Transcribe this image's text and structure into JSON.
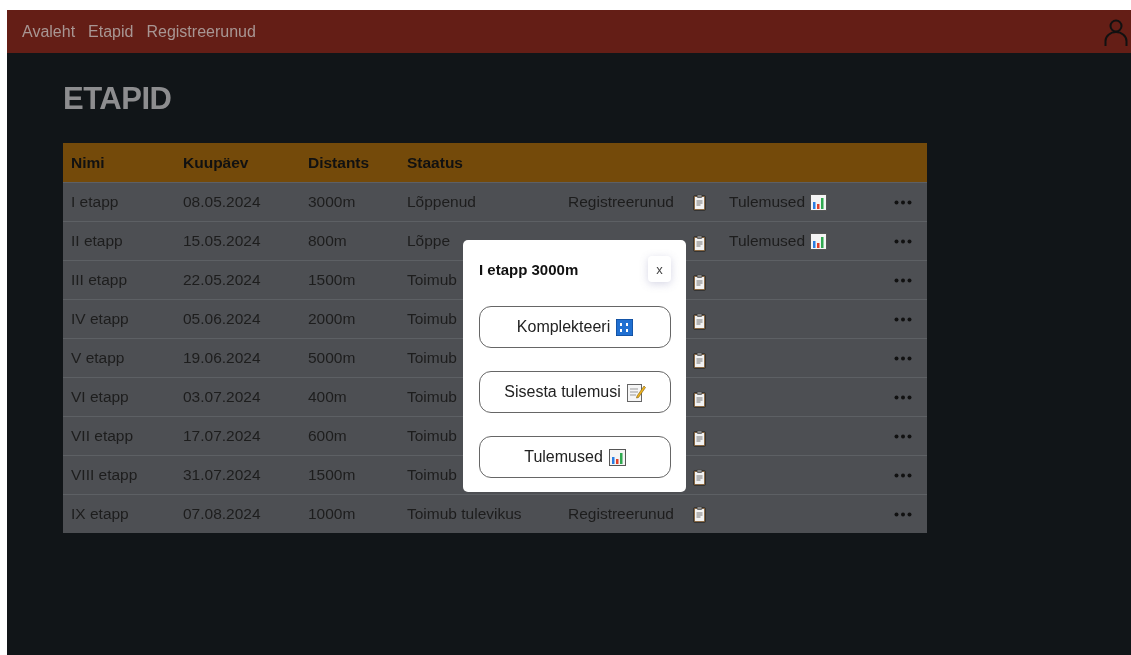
{
  "nav": {
    "links": [
      "Avaleht",
      "Etapid",
      "Registreerunud"
    ]
  },
  "page_title": "ETAPID",
  "table": {
    "columns": [
      "Nimi",
      "Kuupäev",
      "Distants",
      "Staatus"
    ],
    "rows": [
      {
        "name": "I etapp",
        "date": "08.05.2024",
        "distance": "3000m",
        "status": "Lõppenud",
        "registered": "Registreerunud",
        "results": "Tulemused"
      },
      {
        "name": "II etapp",
        "date": "15.05.2024",
        "distance": "800m",
        "status": "Lõppe",
        "results": "Tulemused"
      },
      {
        "name": "III etapp",
        "date": "22.05.2024",
        "distance": "1500m",
        "status": "Toimub"
      },
      {
        "name": "IV etapp",
        "date": "05.06.2024",
        "distance": "2000m",
        "status": "Toimub"
      },
      {
        "name": "V etapp",
        "date": "19.06.2024",
        "distance": "5000m",
        "status": "Toimub"
      },
      {
        "name": "VI etapp",
        "date": "03.07.2024",
        "distance": "400m",
        "status": "Toimub"
      },
      {
        "name": "VII etapp",
        "date": "17.07.2024",
        "distance": "600m",
        "status": "Toimub"
      },
      {
        "name": "VIII etapp",
        "date": "31.07.2024",
        "distance": "1500m",
        "status": "Toimub"
      },
      {
        "name": "IX etapp",
        "date": "07.08.2024",
        "distance": "1000m",
        "status": "Toimub tulevikus",
        "registered": "Registreerunud"
      }
    ]
  },
  "dialog": {
    "title": "I etapp 3000m",
    "close": "x",
    "actions": [
      {
        "label": "Komplekteeri",
        "kind": "numbers"
      },
      {
        "label": "Sisesta tulemusi",
        "kind": "memo"
      },
      {
        "label": "Tulemused",
        "kind": "chart"
      }
    ]
  }
}
